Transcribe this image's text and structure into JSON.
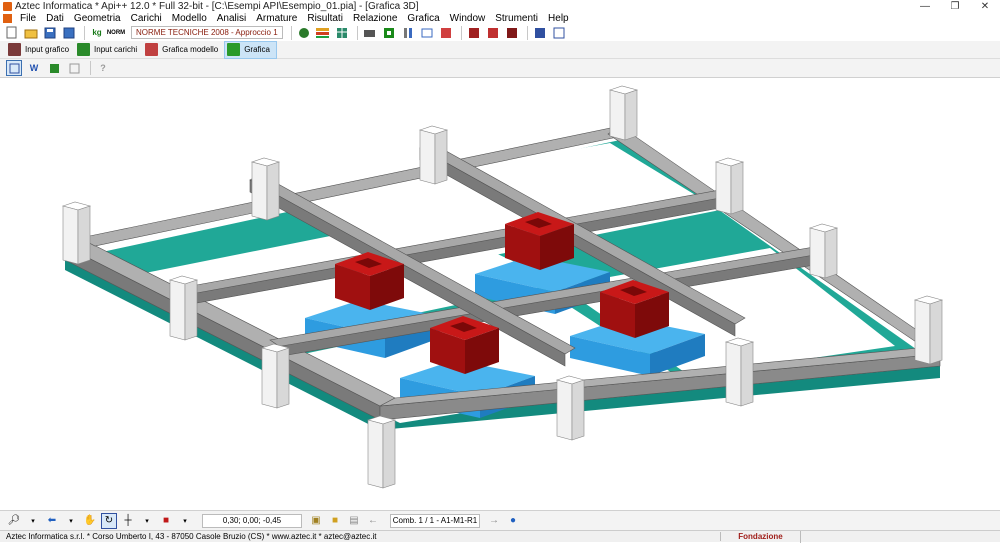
{
  "window": {
    "title": "Aztec Informatica * Api++ 12.0 * Full 32-bit - [C:\\Esempi API\\Esempio_01.pia] - [Grafica 3D]",
    "minimize": "—",
    "maximize": "❐",
    "close": "✕"
  },
  "menu": [
    "File",
    "Dati",
    "Geometria",
    "Carichi",
    "Modello",
    "Analisi",
    "Armature",
    "Risultati",
    "Relazione",
    "Grafica",
    "Window",
    "Strumenti",
    "Help"
  ],
  "toolbar": {
    "norme_label": "NORME TECNICHE 2008 - Approccio 1",
    "kg_label": "kg",
    "norm_label": "NORM"
  },
  "modes": {
    "input_grafico": "Input grafico",
    "input_carichi": "Input carichi",
    "grafica_modello": "Grafica modello",
    "grafica": "Grafica"
  },
  "view_toolbar": {
    "word_label": "W",
    "help_label": "?"
  },
  "bottom": {
    "coordinates": "0,30; 0,00; -0,45",
    "combination": "Comb. 1 / 1 - A1-M1-R1"
  },
  "status": {
    "company": "Aztec Informatica s.r.l. * Corso Umberto I, 43 - 87050 Casole Bruzio (CS) * www.aztec.it * aztec@aztec.it",
    "section": "Fondazione"
  },
  "colors": {
    "beam_top": "#a8a8a8",
    "beam_side": "#7a7a7a",
    "slab_teal": "#1fa89a",
    "plinth_blue": "#2e9ce0",
    "column_red": "#b01010",
    "post_white": "#f2f2f2"
  }
}
